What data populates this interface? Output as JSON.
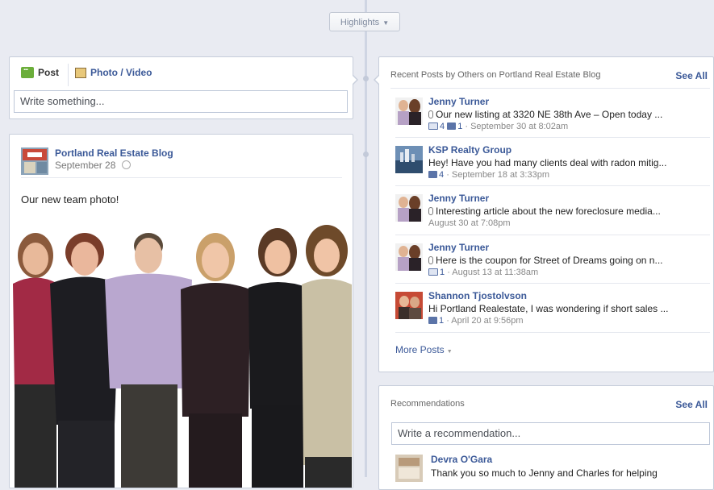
{
  "highlights": {
    "label": "Highlights"
  },
  "composer": {
    "post_tab": "Post",
    "photo_tab": "Photo / Video",
    "placeholder": "Write something..."
  },
  "post": {
    "page_name": "Portland Real Estate Blog",
    "date": "September 28",
    "text": "Our new team photo!"
  },
  "recent_posts": {
    "heading": "Recent Posts by Others on Portland Real Estate Blog",
    "see_all": "See All",
    "items": [
      {
        "name": "Jenny Turner",
        "text": "Our new listing at 3320 NE 38th Ave – Open today ...",
        "likes": "4",
        "comments": "1",
        "time": "· September 30 at 8:02am",
        "attachment": true
      },
      {
        "name": "KSP Realty Group",
        "text": "Hey! Have you had many clients deal with radon mitig...",
        "likes": "",
        "comments": "4",
        "time": "· September 18 at 3:33pm",
        "attachment": false
      },
      {
        "name": "Jenny Turner",
        "text": "Interesting article about the new foreclosure media...",
        "likes": "",
        "comments": "",
        "time": "August 30 at 7:08pm",
        "attachment": true
      },
      {
        "name": "Jenny Turner",
        "text": "Here is the coupon for Street of Dreams going on n...",
        "likes": "1",
        "comments": "",
        "time": "· August 13 at 11:38am",
        "attachment": true
      },
      {
        "name": "Shannon Tjostolvson",
        "text": "Hi Portland Realestate, I was wondering if short sales ...",
        "likes": "",
        "comments": "1",
        "time": "· April 20 at 9:56pm",
        "attachment": false
      }
    ],
    "more": "More Posts"
  },
  "recommendations": {
    "heading": "Recommendations",
    "see_all": "See All",
    "placeholder": "Write a recommendation...",
    "first": {
      "name": "Devra O'Gara",
      "text": "Thank you so much to Jenny and Charles for helping"
    }
  },
  "colors": {
    "link": "#3b5998",
    "spine": "#cfd5e3",
    "background": "#e9ebf2"
  }
}
